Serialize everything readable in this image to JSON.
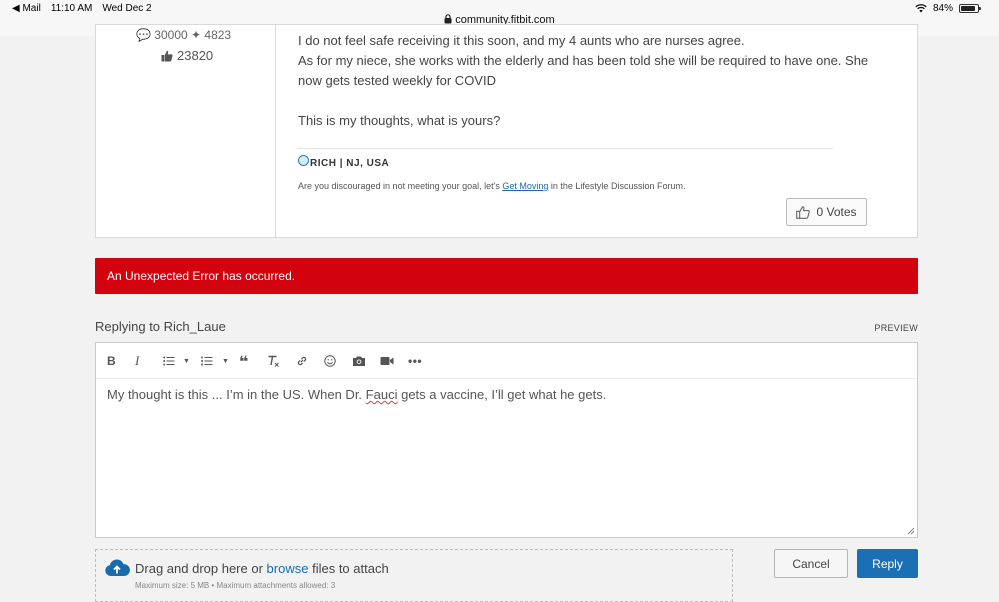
{
  "status_bar": {
    "back_app": "Mail",
    "time": "11:10 AM",
    "date": "Wed Dec 2",
    "url": "community.fitbit.com",
    "battery": "84%"
  },
  "post": {
    "author_stats_cut": "30000 ✦ 4823",
    "kudos_count": "23820",
    "lines": [
      "I do not feel safe receiving it this soon, and my 4 aunts who are nurses agree.",
      "As for my niece, she works with the elderly and has been told she will be required to have one. She now gets tested weekly for COVID",
      "This is my thoughts, what is yours?"
    ],
    "signature": {
      "name": "RICH | NJ, USA",
      "text_before": "Are you discouraged in not meeting your goal, let's",
      "link": "Get Moving",
      "text_after": "in the Lifestyle Discussion Forum."
    },
    "votes_label": "0 Votes"
  },
  "error_message": "An Unexpected Error has occurred.",
  "reply": {
    "title": "Replying to Rich_Laue",
    "preview_label": "PREVIEW",
    "text_before": "My thought is this ... I’m in the US. When Dr.",
    "text_misspelled": "Fauci",
    "text_after": "gets a vaccine, I’ll get what he gets."
  },
  "attach": {
    "text_before": "Drag and drop here or",
    "link": "browse",
    "text_after": "files to attach",
    "limits": "Maximum size: 5 MB • Maximum attachments allowed: 3"
  },
  "buttons": {
    "cancel": "Cancel",
    "reply": "Reply"
  },
  "colors": {
    "error_bg": "#d2020f",
    "primary": "#1b6fb4",
    "link": "#1a6bab"
  }
}
